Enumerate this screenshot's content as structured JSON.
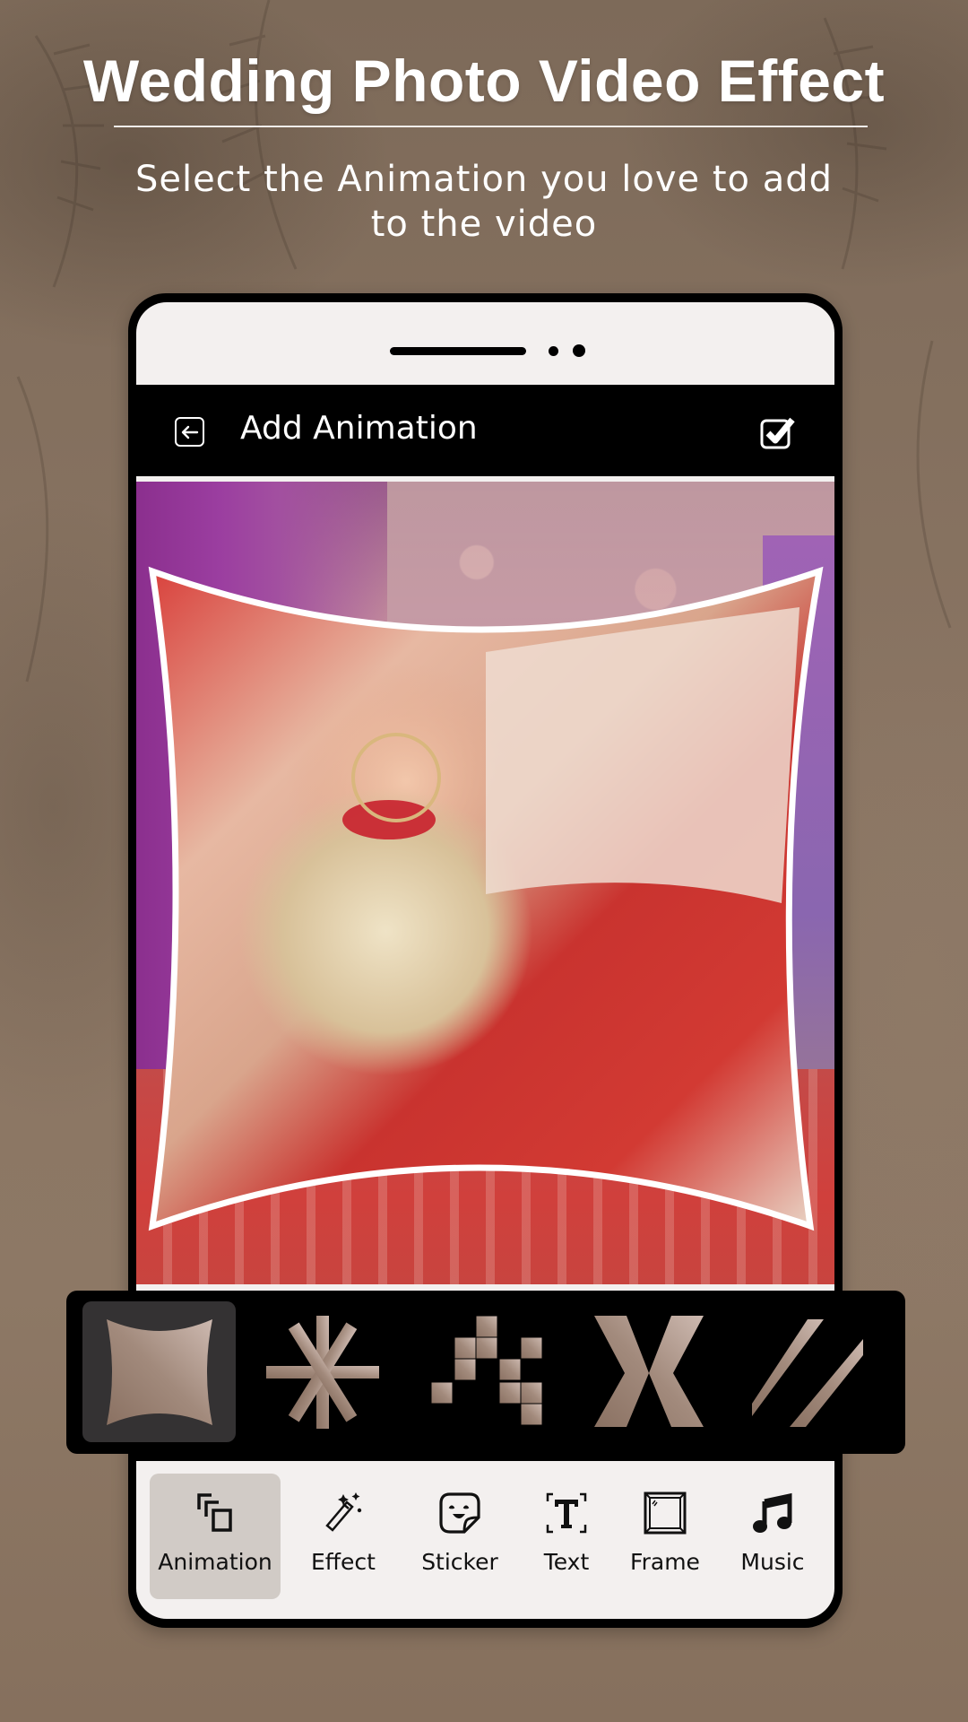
{
  "hero": {
    "title": "Wedding Photo Video Effect",
    "subtitle_line1": "Select the Animation you love to add",
    "subtitle_line2": "to the video"
  },
  "appbar": {
    "back_icon": "back-arrow-box-icon",
    "title": "Add Animation",
    "done_icon": "checkbox-checked-icon"
  },
  "preview": {
    "description": "Bride photo with pillow-warp animation frame"
  },
  "animations": {
    "selected_index": 0,
    "items": [
      {
        "name": "pillow-warp",
        "icon": "concave-square-icon"
      },
      {
        "name": "star-burst",
        "icon": "asterisk-burst-icon"
      },
      {
        "name": "pixel-blocks",
        "icon": "pixel-blocks-icon"
      },
      {
        "name": "cross-x",
        "icon": "x-cross-icon"
      },
      {
        "name": "diagonal-slash",
        "icon": "double-slash-icon"
      }
    ]
  },
  "bottom_nav": {
    "selected_index": 0,
    "items": [
      {
        "label": "Animation",
        "icon": "layers-icon"
      },
      {
        "label": "Effect",
        "icon": "magic-wand-icon"
      },
      {
        "label": "Sticker",
        "icon": "sticker-smiley-icon"
      },
      {
        "label": "Text",
        "icon": "text-T-icon"
      },
      {
        "label": "Frame",
        "icon": "picture-frame-icon"
      },
      {
        "label": "Music",
        "icon": "music-note-icon"
      }
    ]
  },
  "colors": {
    "background": "#86715f",
    "accent_bronze": "#a28a7a",
    "selected_tile": "#343233",
    "selected_nav": "#d1cbc6",
    "phone_surface": "#f3f0ef"
  }
}
